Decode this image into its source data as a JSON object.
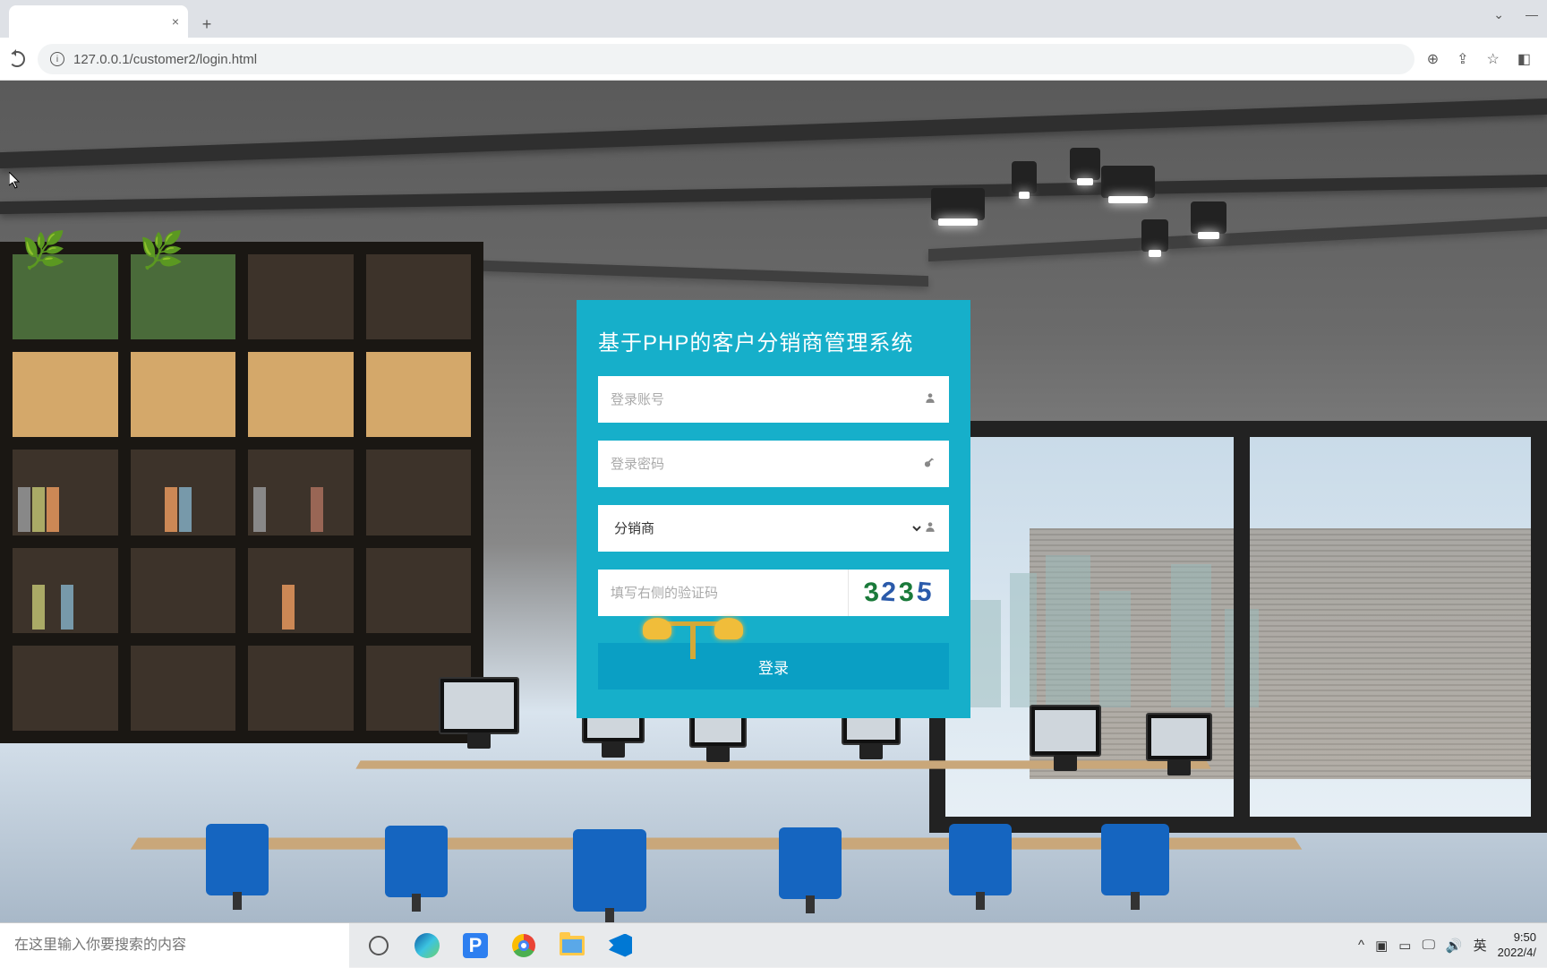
{
  "browser": {
    "tab_title": "",
    "url": "127.0.0.1/customer2/login.html"
  },
  "login": {
    "title": "基于PHP的客户分销商管理系统",
    "username_placeholder": "登录账号",
    "password_placeholder": "登录密码",
    "role_value": "分销商",
    "captcha_placeholder": "填写右侧的验证码",
    "captcha_code": [
      "3",
      "2",
      "3",
      "5"
    ],
    "submit_label": "登录"
  },
  "taskbar": {
    "search_placeholder": "在这里输入你要搜索的内容",
    "ime": "英",
    "time": "9:50",
    "date": "2022/4/"
  }
}
